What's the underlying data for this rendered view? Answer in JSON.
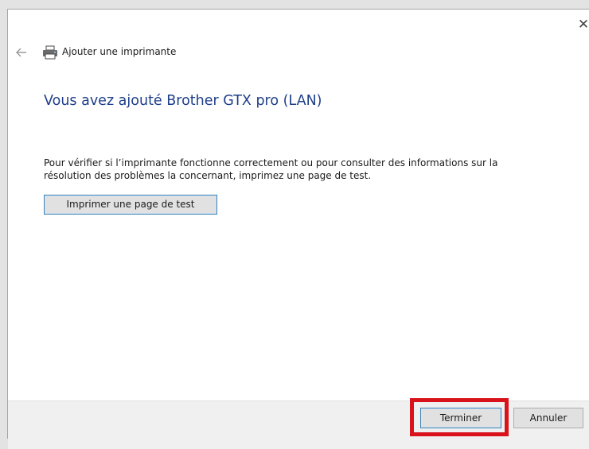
{
  "window": {
    "close_glyph": "✕",
    "title": "Ajouter une imprimante",
    "back_icon": "back-arrow-icon",
    "title_icon": "printer-icon"
  },
  "content": {
    "heading": "Vous avez ajouté Brother GTX pro (LAN)",
    "description_line1": "Pour vérifier si l’imprimante fonctionne correctement ou pour consulter des informations sur la",
    "description_line2": "résolution des problèmes la concernant, imprimez une page de test.",
    "test_button_label": "Imprimer une page de test"
  },
  "footer": {
    "finish_label": "Terminer",
    "cancel_label": "Annuler"
  },
  "colors": {
    "heading": "#1f3f8a",
    "highlight": "#d8131b",
    "button_border_focus": "#3c7fb1"
  }
}
